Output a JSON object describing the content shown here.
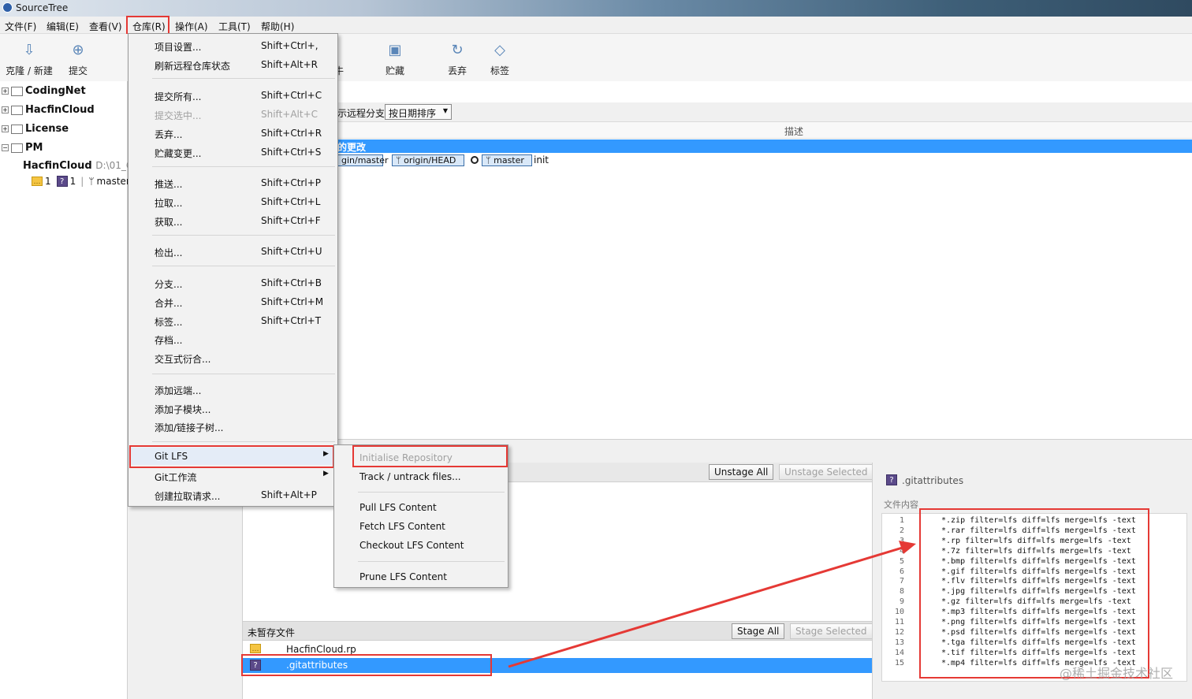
{
  "window": {
    "title": "SourceTree"
  },
  "menubar": [
    "文件(F)",
    "编辑(E)",
    "查看(V)",
    "仓库(R)",
    "操作(A)",
    "工具(T)",
    "帮助(H)"
  ],
  "toolbar": {
    "clone": "克隆 / 新建",
    "commit": "提交",
    "partial": "牛",
    "stash": "贮藏",
    "discard": "丢弃",
    "tag": "标签"
  },
  "sidebar": {
    "repos": [
      "CodingNet",
      "HacfinCloud",
      "License",
      "PM"
    ],
    "active_repo": {
      "name": "HacfinCloud",
      "path": "D:\\01_Co",
      "modified": "1",
      "untracked": "1",
      "branch": "master"
    }
  },
  "filter": {
    "remote_label": "示远程分支",
    "sort": "按日期排序"
  },
  "log": {
    "col_desc": "描述",
    "selected_row": "的更改",
    "tags": [
      "gin/master",
      "origin/HEAD",
      "master"
    ],
    "commit_msg": "init"
  },
  "repo_menu": {
    "items": [
      {
        "label": "项目设置...",
        "shortcut": "Shift+Ctrl+,"
      },
      {
        "label": "刷新远程仓库状态",
        "shortcut": "Shift+Alt+R"
      },
      {
        "label": "提交所有...",
        "shortcut": "Shift+Ctrl+C"
      },
      {
        "label": "提交选中...",
        "shortcut": "Shift+Alt+C"
      },
      {
        "label": "丢弃...",
        "shortcut": "Shift+Ctrl+R"
      },
      {
        "label": "贮藏变更...",
        "shortcut": "Shift+Ctrl+S"
      },
      {
        "label": "推送...",
        "shortcut": "Shift+Ctrl+P"
      },
      {
        "label": "拉取...",
        "shortcut": "Shift+Ctrl+L"
      },
      {
        "label": "获取...",
        "shortcut": "Shift+Ctrl+F"
      },
      {
        "label": "检出...",
        "shortcut": "Shift+Ctrl+U"
      },
      {
        "label": "分支...",
        "shortcut": "Shift+Ctrl+B"
      },
      {
        "label": "合并...",
        "shortcut": "Shift+Ctrl+M"
      },
      {
        "label": "标签...",
        "shortcut": "Shift+Ctrl+T"
      },
      {
        "label": "存档...",
        "shortcut": ""
      },
      {
        "label": "交互式衍合...",
        "shortcut": ""
      },
      {
        "label": "添加远端...",
        "shortcut": ""
      },
      {
        "label": "添加子模块...",
        "shortcut": ""
      },
      {
        "label": "添加/链接子树...",
        "shortcut": ""
      },
      {
        "label": "Git LFS",
        "shortcut": ""
      },
      {
        "label": "Git工作流",
        "shortcut": ""
      },
      {
        "label": "创建拉取请求...",
        "shortcut": "Shift+Alt+P"
      }
    ]
  },
  "lfs_menu": [
    "Initialise Repository",
    "Track / untrack files...",
    "Pull LFS Content",
    "Fetch LFS Content",
    "Checkout LFS Content",
    "Prune LFS Content"
  ],
  "staged": {
    "unstage_all": "Unstage All",
    "unstage_selected": "Unstage Selected"
  },
  "unstaged": {
    "header": "未暂存文件",
    "stage_all": "Stage All",
    "stage_selected": "Stage Selected",
    "files": [
      "HacfinCloud.rp",
      ".gitattributes"
    ]
  },
  "preview": {
    "filename": ".gitattributes",
    "section": "文件内容",
    "lines": [
      "*.zip filter=lfs diff=lfs merge=lfs -text",
      "*.rar filter=lfs diff=lfs merge=lfs -text",
      "*.rp filter=lfs diff=lfs merge=lfs -text",
      "*.7z filter=lfs diff=lfs merge=lfs -text",
      "*.bmp filter=lfs diff=lfs merge=lfs -text",
      "*.gif filter=lfs diff=lfs merge=lfs -text",
      "*.flv filter=lfs diff=lfs merge=lfs -text",
      "*.jpg filter=lfs diff=lfs merge=lfs -text",
      "*.gz filter=lfs diff=lfs merge=lfs -text",
      "*.mp3 filter=lfs diff=lfs merge=lfs -text",
      "*.png filter=lfs diff=lfs merge=lfs -text",
      "*.psd filter=lfs diff=lfs merge=lfs -text",
      "*.tga filter=lfs diff=lfs merge=lfs -text",
      "*.tif filter=lfs diff=lfs merge=lfs -text",
      "*.mp4 filter=lfs diff=lfs merge=lfs -text"
    ]
  },
  "watermark": "@稀土掘金技术社区",
  "colors": {
    "selection": "#3399ff",
    "annotation": "#e53935",
    "icon_blue": "#5a86b8"
  }
}
